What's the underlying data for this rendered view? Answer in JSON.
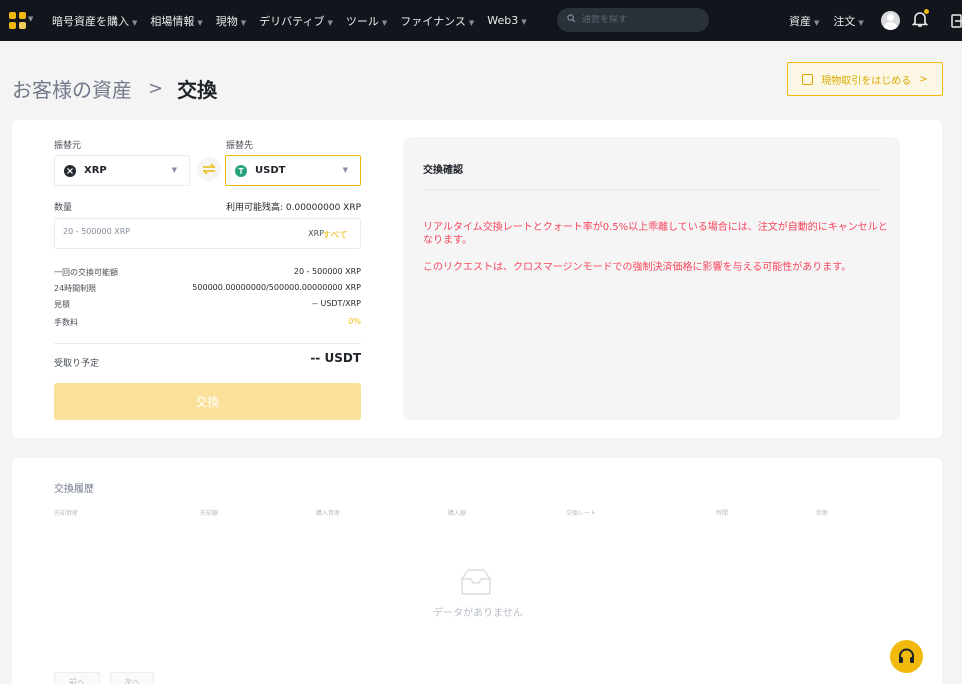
{
  "colors": {
    "accent": "#f0b90b",
    "topbar": "#12161c",
    "warning": "#f6465d",
    "button_disabled": "#fbe09a"
  },
  "topnav": {
    "logo": "binance-grid-logo",
    "items": [
      {
        "label": "暗号資産を購入"
      },
      {
        "label": "相場情報"
      },
      {
        "label": "現物"
      },
      {
        "label": "デリバティブ"
      },
      {
        "label": "ツール"
      },
      {
        "label": "ファイナンス"
      },
      {
        "label": "Web3"
      }
    ],
    "search_placeholder": "通貨を探す",
    "right_items": [
      {
        "label": "資産"
      },
      {
        "label": "注文"
      }
    ]
  },
  "header": {
    "breadcrumb_parent": "お客様の資産",
    "breadcrumb_sep": ">",
    "breadcrumb_current": "交換",
    "spot_button": "現物取引をはじめる",
    "spot_button_chevron": ">"
  },
  "convert": {
    "from_label": "振替元",
    "to_label": "振替先",
    "from_coin": "XRP",
    "to_coin": "USDT",
    "amount_label": "数量",
    "available": "利用可能残高: 0.00000000 XRP",
    "amount_placeholder": "20 - 500000 XRP",
    "amount_unit": "XRP",
    "amount_all": "すべて",
    "details": [
      {
        "label": "一回の交換可能額",
        "value": "20 - 500000 XRP"
      },
      {
        "label": "24時間制限",
        "value": "500000.00000000/500000.00000000 XRP"
      },
      {
        "label": "見積",
        "value": "-- USDT/XRP"
      },
      {
        "label": "手数料",
        "value": "0%"
      }
    ],
    "receive_label": "受取り予定",
    "receive_value": "-- USDT",
    "exchange_button": "交換"
  },
  "confirm": {
    "title": "交換確認",
    "warning_1": "リアルタイム交換レートとクォート率が0.5%以上乖離している場合には、注文が自動的にキャンセルとなります。",
    "warning_2": "このリクエストは、クロスマージンモードでの強制決済価格に影響を与える可能性があります。"
  },
  "history": {
    "title": "交換履歴",
    "columns": [
      "売却資産",
      "売却額",
      "購入資産",
      "購入額",
      "交換レート",
      "時間",
      "状態"
    ],
    "empty_text": "データがありません",
    "prev_label": "前へ",
    "next_label": "次へ"
  }
}
